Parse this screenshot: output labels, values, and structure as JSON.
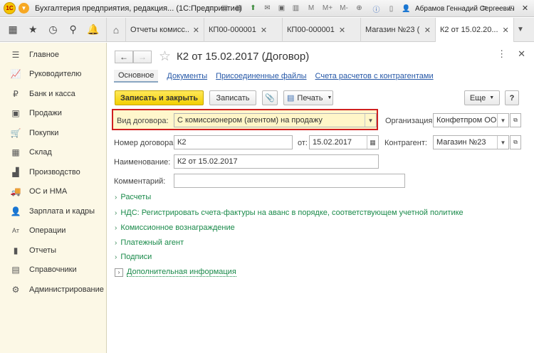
{
  "titlebar": {
    "logo_text": "1С",
    "app_title": "Бухгалтерия предприятия, редакция... (1С:Предприятие)",
    "icons": [
      "minus-square-icon",
      "print-icon",
      "print-preview-icon",
      "save-icon",
      "mail-icon",
      "calendar-icon",
      "calculator-icon"
    ],
    "m_buttons": [
      "M",
      "M+",
      "M-"
    ],
    "user": "Абрамов Геннадий Сергеевич"
  },
  "tabs": {
    "items": [
      {
        "label": "Отчеты комисс..."
      },
      {
        "label": "КП00-000001"
      },
      {
        "label": "КП00-000001"
      },
      {
        "label": "Магазин №23 (..."
      },
      {
        "label": "К2 от 15.02.20..."
      }
    ]
  },
  "sidebar": {
    "items": [
      {
        "label": "Главное",
        "icon": "menu-icon"
      },
      {
        "label": "Руководителю",
        "icon": "chart-icon"
      },
      {
        "label": "Банк и касса",
        "icon": "ruble-icon"
      },
      {
        "label": "Продажи",
        "icon": "bag-icon"
      },
      {
        "label": "Покупки",
        "icon": "cart-icon"
      },
      {
        "label": "Склад",
        "icon": "grid-icon"
      },
      {
        "label": "Производство",
        "icon": "factory-icon"
      },
      {
        "label": "ОС и НМА",
        "icon": "car-icon"
      },
      {
        "label": "Зарплата и кадры",
        "icon": "person-icon"
      },
      {
        "label": "Операции",
        "icon": "dt-kt-icon"
      },
      {
        "label": "Отчеты",
        "icon": "bars-icon"
      },
      {
        "label": "Справочники",
        "icon": "book-icon"
      },
      {
        "label": "Администрирование",
        "icon": "gear-icon"
      }
    ]
  },
  "form": {
    "title": "К2 от 15.02.2017 (Договор)",
    "links": {
      "active": "Основное",
      "items": [
        "Документы",
        "Присоединенные файлы",
        "Счета расчетов с контрагентами"
      ]
    },
    "toolbar": {
      "save_close": "Записать и закрыть",
      "save": "Записать",
      "print": "Печать",
      "more": "Еще",
      "help": "?"
    },
    "fields": {
      "contract_type_label": "Вид договора:",
      "contract_type_value": "С комиссионером (агентом) на продажу",
      "org_label": "Организация:",
      "org_value": "Конфетпром ООО",
      "number_label": "Номер договора:",
      "number_value": "К2",
      "date_label": "от:",
      "date_value": "15.02.2017",
      "counterparty_label": "Контрагент:",
      "counterparty_value": "Магазин №23",
      "name_label": "Наименование:",
      "name_value": "К2 от 15.02.2017",
      "comment_label": "Комментарий:",
      "comment_value": ""
    },
    "sections": [
      "Расчеты",
      "НДС: Регистрировать счета-фактуры на аванс в порядке, соответствующем учетной политике",
      "Комиссионное вознаграждение",
      "Платежный агент",
      "Подписи",
      "Дополнительная информация"
    ]
  }
}
